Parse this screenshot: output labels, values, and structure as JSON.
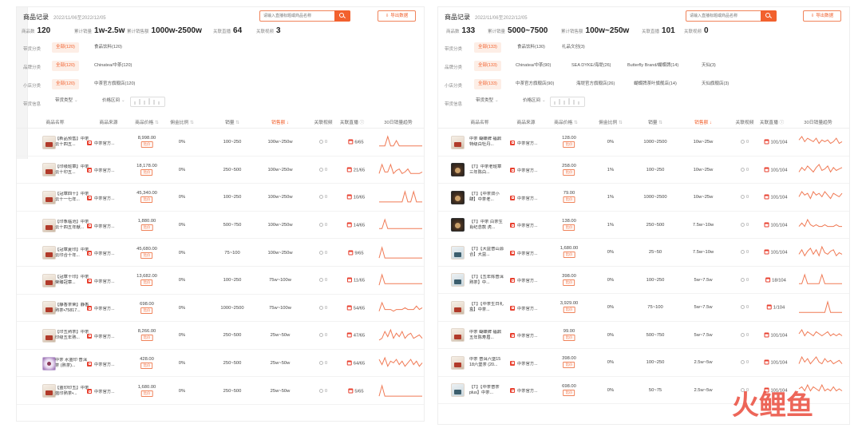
{
  "colors": {
    "accent": "#f2612e",
    "spark": "#f07a55"
  },
  "columns": [
    "商品名称",
    "商品来源",
    "商品价格",
    "佣金比例",
    "销量",
    "销售额",
    "关联视频",
    "关联直播",
    "30日销量趋势"
  ],
  "left": {
    "header": {
      "title": "商品记录",
      "date": "2022/11/06至2022/12/05",
      "search_placeholder": "请输入直播标题或商品名称",
      "export_label": "导出数据"
    },
    "stats": [
      {
        "label": "商品数",
        "value": "120"
      },
      {
        "label": "累计销量",
        "value": "1w-2.5w"
      },
      {
        "label": "累计销售额",
        "value": "1000w-2500w"
      },
      {
        "label": "关联直播",
        "value": "64"
      },
      {
        "label": "关联视频",
        "value": "3"
      }
    ],
    "filters": [
      {
        "label": "带货分类",
        "chips": [
          "全部(120)",
          "食品饮料(120)"
        ]
      },
      {
        "label": "品牌分类",
        "chips": [
          "全部(120)",
          "Chinatea/中茶(120)"
        ]
      },
      {
        "label": "小店分类",
        "chips": [
          "全部(120)",
          "中茶官方旗舰店(120)"
        ]
      },
      {
        "label": "带货信息",
        "chips": [
          "带货类型",
          "价格区间"
        ]
      }
    ],
    "rows": [
      {
        "name": "【新品预售】中茶 云十四五...",
        "src": "中茶官方...",
        "price": "8,998.00",
        "ratio": "0%",
        "sales": "100~250",
        "amount": "100w~250w",
        "video": "0",
        "live": "6/65",
        "trend": [
          2,
          2,
          2,
          9,
          2,
          2,
          6,
          2,
          2,
          2,
          2,
          2,
          2,
          2,
          2,
          2
        ]
      },
      {
        "name": "【印级班章】中茶 云十印五...",
        "src": "中茶官方...",
        "price": "18,178.00",
        "ratio": "0%",
        "sales": "250~500",
        "amount": "100w~250w",
        "video": "0",
        "live": "21/65",
        "trend": [
          2,
          8,
          3,
          3,
          8,
          2,
          4,
          5,
          2,
          3,
          5,
          2,
          2,
          2,
          2,
          3
        ]
      },
      {
        "name": "【冠章四十】中茶 云十一七年...",
        "src": "中茶官方...",
        "price": "45,340.00",
        "ratio": "0%",
        "sales": "100~250",
        "amount": "100w~250w",
        "video": "0",
        "live": "10/65",
        "trend": [
          1,
          1,
          1,
          1,
          1,
          1,
          1,
          1,
          1,
          7,
          1,
          1,
          7,
          1,
          1,
          1
        ]
      },
      {
        "name": "【印象临沧】中茶 云十四五年献...",
        "src": "中茶官方...",
        "price": "1,880.00",
        "ratio": "0%",
        "sales": "500~750",
        "amount": "100w~250w",
        "video": "0",
        "live": "14/65",
        "trend": [
          2,
          2,
          8,
          2,
          2,
          2,
          2,
          2,
          2,
          2,
          2,
          2,
          2,
          2,
          2,
          2
        ]
      },
      {
        "name": "【冠章夏印】中茶 云印合十年...",
        "src": "中茶官方...",
        "price": "45,680.00",
        "ratio": "0%",
        "sales": "75~100",
        "amount": "100w~250w",
        "video": "0",
        "live": "9/65",
        "trend": [
          1,
          8,
          1,
          1,
          1,
          1,
          1,
          1,
          1,
          1,
          1,
          1,
          1,
          1,
          1,
          1
        ]
      },
      {
        "name": "【冠章十印】中茶 荣臻冠章...",
        "src": "中茶官方...",
        "price": "13,682.00",
        "ratio": "0%",
        "sales": "100~250",
        "amount": "75w~100w",
        "video": "0",
        "live": "11/65",
        "trend": [
          1,
          8,
          2,
          2,
          2,
          2,
          2,
          2,
          2,
          2,
          2,
          2,
          2,
          2,
          2,
          2
        ]
      },
      {
        "name": "【静香茶荣】静香熟茶•75817...",
        "src": "中茶官方...",
        "price": "698.00",
        "ratio": "0%",
        "sales": "1000~2500",
        "amount": "75w~100w",
        "video": "0",
        "live": "54/65",
        "trend": [
          2,
          7,
          3,
          3,
          3,
          2,
          3,
          3,
          3,
          4,
          3,
          3,
          3,
          5,
          3,
          4
        ]
      },
      {
        "name": "【印五熟茶】中茶 印级五年熟...",
        "src": "中茶官方...",
        "price": "8,266.00",
        "ratio": "0%",
        "sales": "250~500",
        "amount": "25w~50w",
        "video": "0",
        "live": "47/65",
        "trend": [
          1,
          2,
          6,
          3,
          7,
          2,
          5,
          3,
          6,
          2,
          4,
          5,
          2,
          3,
          4,
          2
        ]
      },
      {
        "name": "中茶 水蓝印 普洱茶 (熟茶)...",
        "src": "中茶官方...",
        "price": "428.00",
        "ratio": "0%",
        "sales": "250~500",
        "amount": "25w~50w",
        "video": "0",
        "live": "64/65",
        "trend": [
          6,
          3,
          7,
          2,
          5,
          4,
          6,
          3,
          5,
          2,
          4,
          6,
          3,
          5,
          2,
          4
        ]
      },
      {
        "name": "【蓝印印五】中茶 蓝印熟茶•...",
        "src": "中茶官方...",
        "price": "1,680.00",
        "ratio": "0%",
        "sales": "250~500",
        "amount": "25w~50w",
        "video": "0",
        "live": "5/65",
        "trend": [
          1,
          8,
          1,
          1,
          1,
          1,
          1,
          1,
          1,
          1,
          1,
          1,
          1,
          1,
          1,
          1
        ]
      }
    ]
  },
  "right": {
    "header": {
      "title": "商品记录",
      "date": "2022/11/06至2022/12/05",
      "search_placeholder": "请输入直播标题或商品名称",
      "export_label": "导出数据"
    },
    "stats": [
      {
        "label": "商品数",
        "value": "133"
      },
      {
        "label": "累计销量",
        "value": "5000~7500"
      },
      {
        "label": "累计销售额",
        "value": "100w~250w"
      },
      {
        "label": "关联直播",
        "value": "101"
      },
      {
        "label": "关联视频",
        "value": "0"
      }
    ],
    "filters": [
      {
        "label": "带货分类",
        "chips": [
          "全部(133)",
          "食品饮料(130)",
          "礼品文创(3)"
        ]
      },
      {
        "label": "品牌分类",
        "chips": [
          "全部(133)",
          "Chinatea/中茶(90)",
          "SEA DYKE/海堤(26)",
          "Butterfly Brand/蝴蝶牌(14)",
          "天仙(3)"
        ]
      },
      {
        "label": "小店分类",
        "chips": [
          "全部(133)",
          "中茶官方旗舰店(90)",
          "海堤官方旗舰店(26)",
          "蝴蝶牌茶叶旗舰店(14)",
          "天仙旗舰店(3)"
        ]
      },
      {
        "label": "带货信息",
        "chips": [
          "带货类型",
          "价格区间"
        ]
      }
    ],
    "rows": [
      {
        "name": "中茶 蝴蝶牌 福鼎特级白牡丹...",
        "src": "中茶官方...",
        "price": "128.00",
        "ratio": "0%",
        "sales": "1000~2500",
        "amount": "10w~25w",
        "video": "0",
        "live": "101/104",
        "trend": [
          5,
          7,
          4,
          6,
          5,
          4,
          6,
          3,
          5,
          4,
          5,
          3,
          4,
          6,
          3,
          4
        ]
      },
      {
        "name": "【T】中茶老班章三年陈白...",
        "src": "中茶官方...",
        "price": "258.00",
        "ratio": "1%",
        "sales": "100~250",
        "amount": "10w~25w",
        "video": "0",
        "live": "101/104",
        "trend": [
          3,
          6,
          4,
          7,
          5,
          3,
          6,
          8,
          4,
          5,
          7,
          3,
          6,
          4,
          5,
          6
        ]
      },
      {
        "name": "【T】【中茶双小肆】中茶老...",
        "src": "中茶官方...",
        "price": "79.00",
        "ratio": "1%",
        "sales": "1000~2500",
        "amount": "10w~25w",
        "video": "0",
        "live": "101/104",
        "trend": [
          4,
          7,
          5,
          6,
          3,
          7,
          5,
          6,
          4,
          7,
          5,
          3,
          6,
          5,
          4,
          6
        ]
      },
      {
        "name": "【T】中茶 白茶生肖纪念款 虎...",
        "src": "中茶官方...",
        "price": "138.00",
        "ratio": "1%",
        "sales": "250~500",
        "amount": "7.5w~10w",
        "video": "0",
        "live": "101/104",
        "trend": [
          3,
          5,
          3,
          7,
          4,
          3,
          4,
          3,
          3,
          4,
          3,
          3,
          3,
          4,
          3,
          3
        ]
      },
      {
        "name": "【T】【大益普山源合】大益...",
        "src": "中茶官方...",
        "price": "1,680.00",
        "ratio": "0%",
        "sales": "25~50",
        "amount": "7.5w~10w",
        "video": "0",
        "live": "101/104",
        "trend": [
          3,
          6,
          2,
          5,
          7,
          3,
          6,
          2,
          8,
          4,
          3,
          5,
          6,
          2,
          4,
          3
        ]
      },
      {
        "name": "【T】【五年陈普洱熟茶】中...",
        "src": "中茶官方...",
        "price": "398.00",
        "ratio": "0%",
        "sales": "100~250",
        "amount": "5w~7.5w",
        "video": "0",
        "live": "18/104",
        "trend": [
          2,
          2,
          8,
          2,
          2,
          2,
          2,
          2,
          8,
          2,
          2,
          2,
          2,
          2,
          2,
          2
        ]
      },
      {
        "name": "【T】【中茶生日礼盒】中茶...",
        "src": "中茶官方...",
        "price": "3,929.00",
        "ratio": "0%",
        "sales": "75~100",
        "amount": "5w~7.5w",
        "video": "0",
        "live": "1/104",
        "trend": [
          1,
          1,
          1,
          1,
          1,
          1,
          1,
          1,
          1,
          1,
          9,
          1,
          1,
          1,
          1,
          1
        ]
      },
      {
        "name": "中茶 蝴蝶牌 福鼎五年陈寿眉...",
        "src": "中茶官方...",
        "price": "99.00",
        "ratio": "0%",
        "sales": "500~750",
        "amount": "5w~7.5w",
        "video": "0",
        "live": "101/104",
        "trend": [
          4,
          6,
          3,
          5,
          4,
          3,
          5,
          4,
          3,
          4,
          5,
          3,
          4,
          3,
          4,
          3
        ]
      },
      {
        "name": "中茶 普洱六堡15 18六堡茶 (20...",
        "src": "中茶官方...",
        "price": "398.00",
        "ratio": "0%",
        "sales": "100~250",
        "amount": "2.5w~5w",
        "video": "0",
        "live": "101/104",
        "trend": [
          3,
          7,
          4,
          6,
          3,
          5,
          7,
          4,
          3,
          6,
          4,
          5,
          3,
          4,
          5,
          3
        ]
      },
      {
        "name": "【T】【中茶普茶plus】中茶...",
        "src": "中茶官方...",
        "price": "698.00",
        "ratio": "0%",
        "sales": "50~75",
        "amount": "2.5w~5w",
        "video": "0",
        "live": "101/104",
        "trend": [
          4,
          5,
          3,
          6,
          3,
          5,
          4,
          3,
          6,
          3,
          4,
          3,
          5,
          3,
          4,
          3
        ]
      }
    ]
  },
  "watermark": {
    "text": "火鲤鱼"
  }
}
